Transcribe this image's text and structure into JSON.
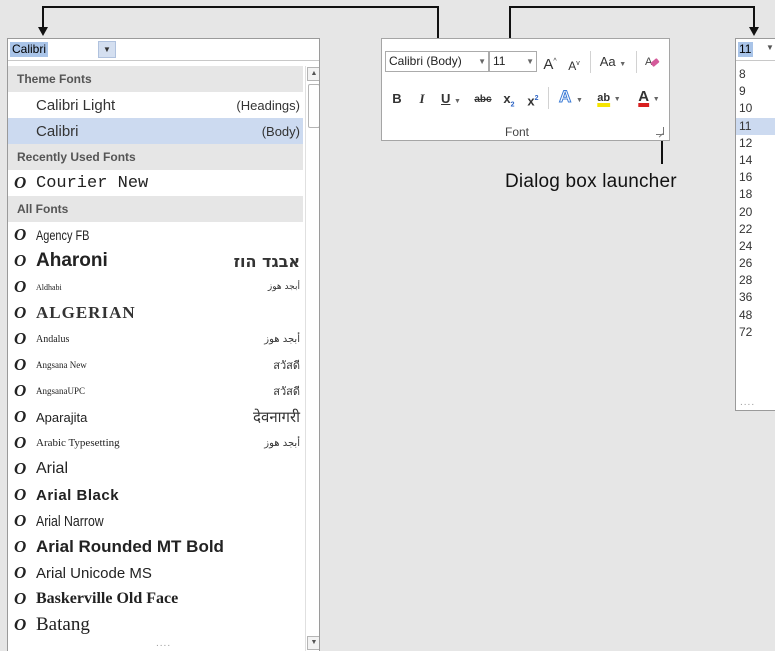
{
  "font_dropdown": {
    "current_value": "Calibri",
    "sections": {
      "theme": "Theme Fonts",
      "recent": "Recently Used Fonts",
      "all": "All Fonts"
    },
    "theme_fonts": [
      {
        "name": "Calibri Light",
        "tag": "(Headings)"
      },
      {
        "name": "Calibri",
        "tag": "(Body)"
      }
    ],
    "recent_fonts": [
      {
        "name": "Courier New",
        "sample": ""
      }
    ],
    "all_fonts": [
      {
        "name": "Agency FB",
        "sample": ""
      },
      {
        "name": "Aharoni",
        "sample": "אבגד הוז"
      },
      {
        "name": "Aldhabi",
        "sample": "أبجد هوز"
      },
      {
        "name": "ALGERIAN",
        "sample": ""
      },
      {
        "name": "Andalus",
        "sample": "أبجد هوز"
      },
      {
        "name": "Angsana New",
        "sample": "สวัสดี"
      },
      {
        "name": "AngsanaUPC",
        "sample": "สวัสดี"
      },
      {
        "name": "Aparajita",
        "sample": "देवनागरी"
      },
      {
        "name": "Arabic Typesetting",
        "sample": "أبجد هوز"
      },
      {
        "name": "Arial",
        "sample": ""
      },
      {
        "name": "Arial Black",
        "sample": ""
      },
      {
        "name": "Arial Narrow",
        "sample": ""
      },
      {
        "name": "Arial Rounded MT Bold",
        "sample": ""
      },
      {
        "name": "Arial Unicode MS",
        "sample": ""
      },
      {
        "name": "Baskerville Old Face",
        "sample": ""
      },
      {
        "name": "Batang",
        "sample": ""
      }
    ],
    "truetype_icon": "O",
    "resize_grip": "....",
    "scroll_up_icon": "▲",
    "scroll_down_icon": "▼"
  },
  "ribbon": {
    "font_name": "Calibri (Body)",
    "font_size": "11",
    "grow_font": "A",
    "shrink_font": "A",
    "change_case": "Aa",
    "bold": "B",
    "italic": "I",
    "underline": "U",
    "strikethrough": "abc",
    "subscript": "x",
    "subscript_mark": "2",
    "superscript": "x",
    "superscript_mark": "2",
    "text_effects": "A",
    "highlight": "ab",
    "font_color": "A",
    "group_caption": "Font",
    "highlight_color": "#f5e400",
    "font_color_bar": "#d92020",
    "clear_format_color": "#d45a9a"
  },
  "callout": {
    "label": "Dialog box launcher"
  },
  "size_dropdown": {
    "current_value": "11",
    "sizes": [
      "8",
      "9",
      "10",
      "11",
      "12",
      "14",
      "16",
      "18",
      "20",
      "22",
      "24",
      "26",
      "28",
      "36",
      "48",
      "72"
    ],
    "selected": "11",
    "resize_grip": "...."
  }
}
